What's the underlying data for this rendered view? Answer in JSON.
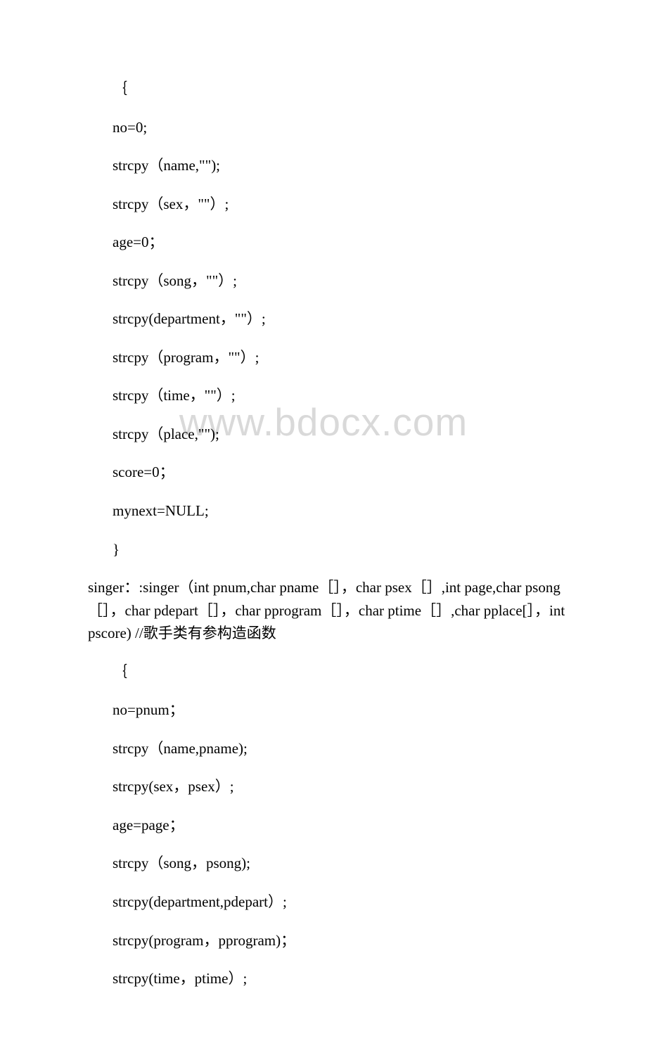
{
  "watermark": "www.bdocx.com",
  "lines": [
    {
      "cls": "indent1",
      "text": "｛"
    },
    {
      "cls": "indent1",
      "text": "no=0;"
    },
    {
      "cls": "indent1",
      "text": "strcpy（name,\"\");"
    },
    {
      "cls": "indent1",
      "text": "strcpy（sex，\"\"）;"
    },
    {
      "cls": "indent1",
      "text": "age=0；"
    },
    {
      "cls": "indent1",
      "text": "strcpy（song，\"\"）;"
    },
    {
      "cls": "indent1",
      "text": "strcpy(department，\"\"）;"
    },
    {
      "cls": "indent1",
      "text": "strcpy（program，\"\"）;"
    },
    {
      "cls": "indent1",
      "text": "strcpy（time，\"\"）;"
    },
    {
      "cls": "indent1",
      "text": "strcpy（place,\"\");"
    },
    {
      "cls": "indent1",
      "text": "score=0；"
    },
    {
      "cls": "indent1",
      "text": "mynext=NULL;"
    },
    {
      "cls": "indent1",
      "text": "}"
    },
    {
      "cls": "indent0",
      "text": "singer：:singer（int pnum,char pname［］，char psex［］,int page,char psong［］，char pdepart［］，char pprogram［］，char ptime［］,char pplace[］，int pscore) //歌手类有参构造函数"
    },
    {
      "cls": "indent1",
      "text": "｛"
    },
    {
      "cls": "indent1",
      "text": "no=pnum；"
    },
    {
      "cls": "indent1",
      "text": "strcpy（name,pname);"
    },
    {
      "cls": "indent1",
      "text": "strcpy(sex，psex）;"
    },
    {
      "cls": "indent1",
      "text": "age=page；"
    },
    {
      "cls": "indent1",
      "text": "strcpy（song，psong);"
    },
    {
      "cls": "indent1",
      "text": "strcpy(department,pdepart）;"
    },
    {
      "cls": "indent1",
      "text": "strcpy(program，pprogram)；"
    },
    {
      "cls": "indent1",
      "text": "strcpy(time，ptime）;"
    }
  ]
}
